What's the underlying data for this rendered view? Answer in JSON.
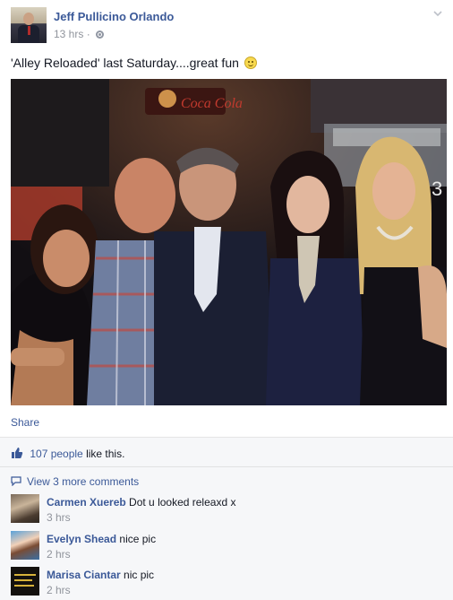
{
  "post": {
    "author": "Jeff Pullicino Orlando",
    "time": "13 hrs",
    "separator": "·",
    "text": "'Alley Reloaded' last Saturday....great fun",
    "share_label": "Share"
  },
  "photo": {
    "sign_text": "Coca Cola",
    "side_text": "3"
  },
  "likes": {
    "count": "107 people",
    "suffix": " like this."
  },
  "comments": {
    "more_label": "View 3 more comments",
    "items": [
      {
        "name": "Carmen Xuereb",
        "text": "Dot u looked releaxd x",
        "time": "3 hrs"
      },
      {
        "name": "Evelyn Shead",
        "text": "nice pic",
        "time": "2 hrs"
      },
      {
        "name": "Marisa Ciantar",
        "text": "nic pic",
        "time": "2 hrs"
      }
    ]
  },
  "colors": {
    "link": "#3b5998",
    "meta": "#90949c",
    "footer_bg": "#f6f7f9"
  }
}
